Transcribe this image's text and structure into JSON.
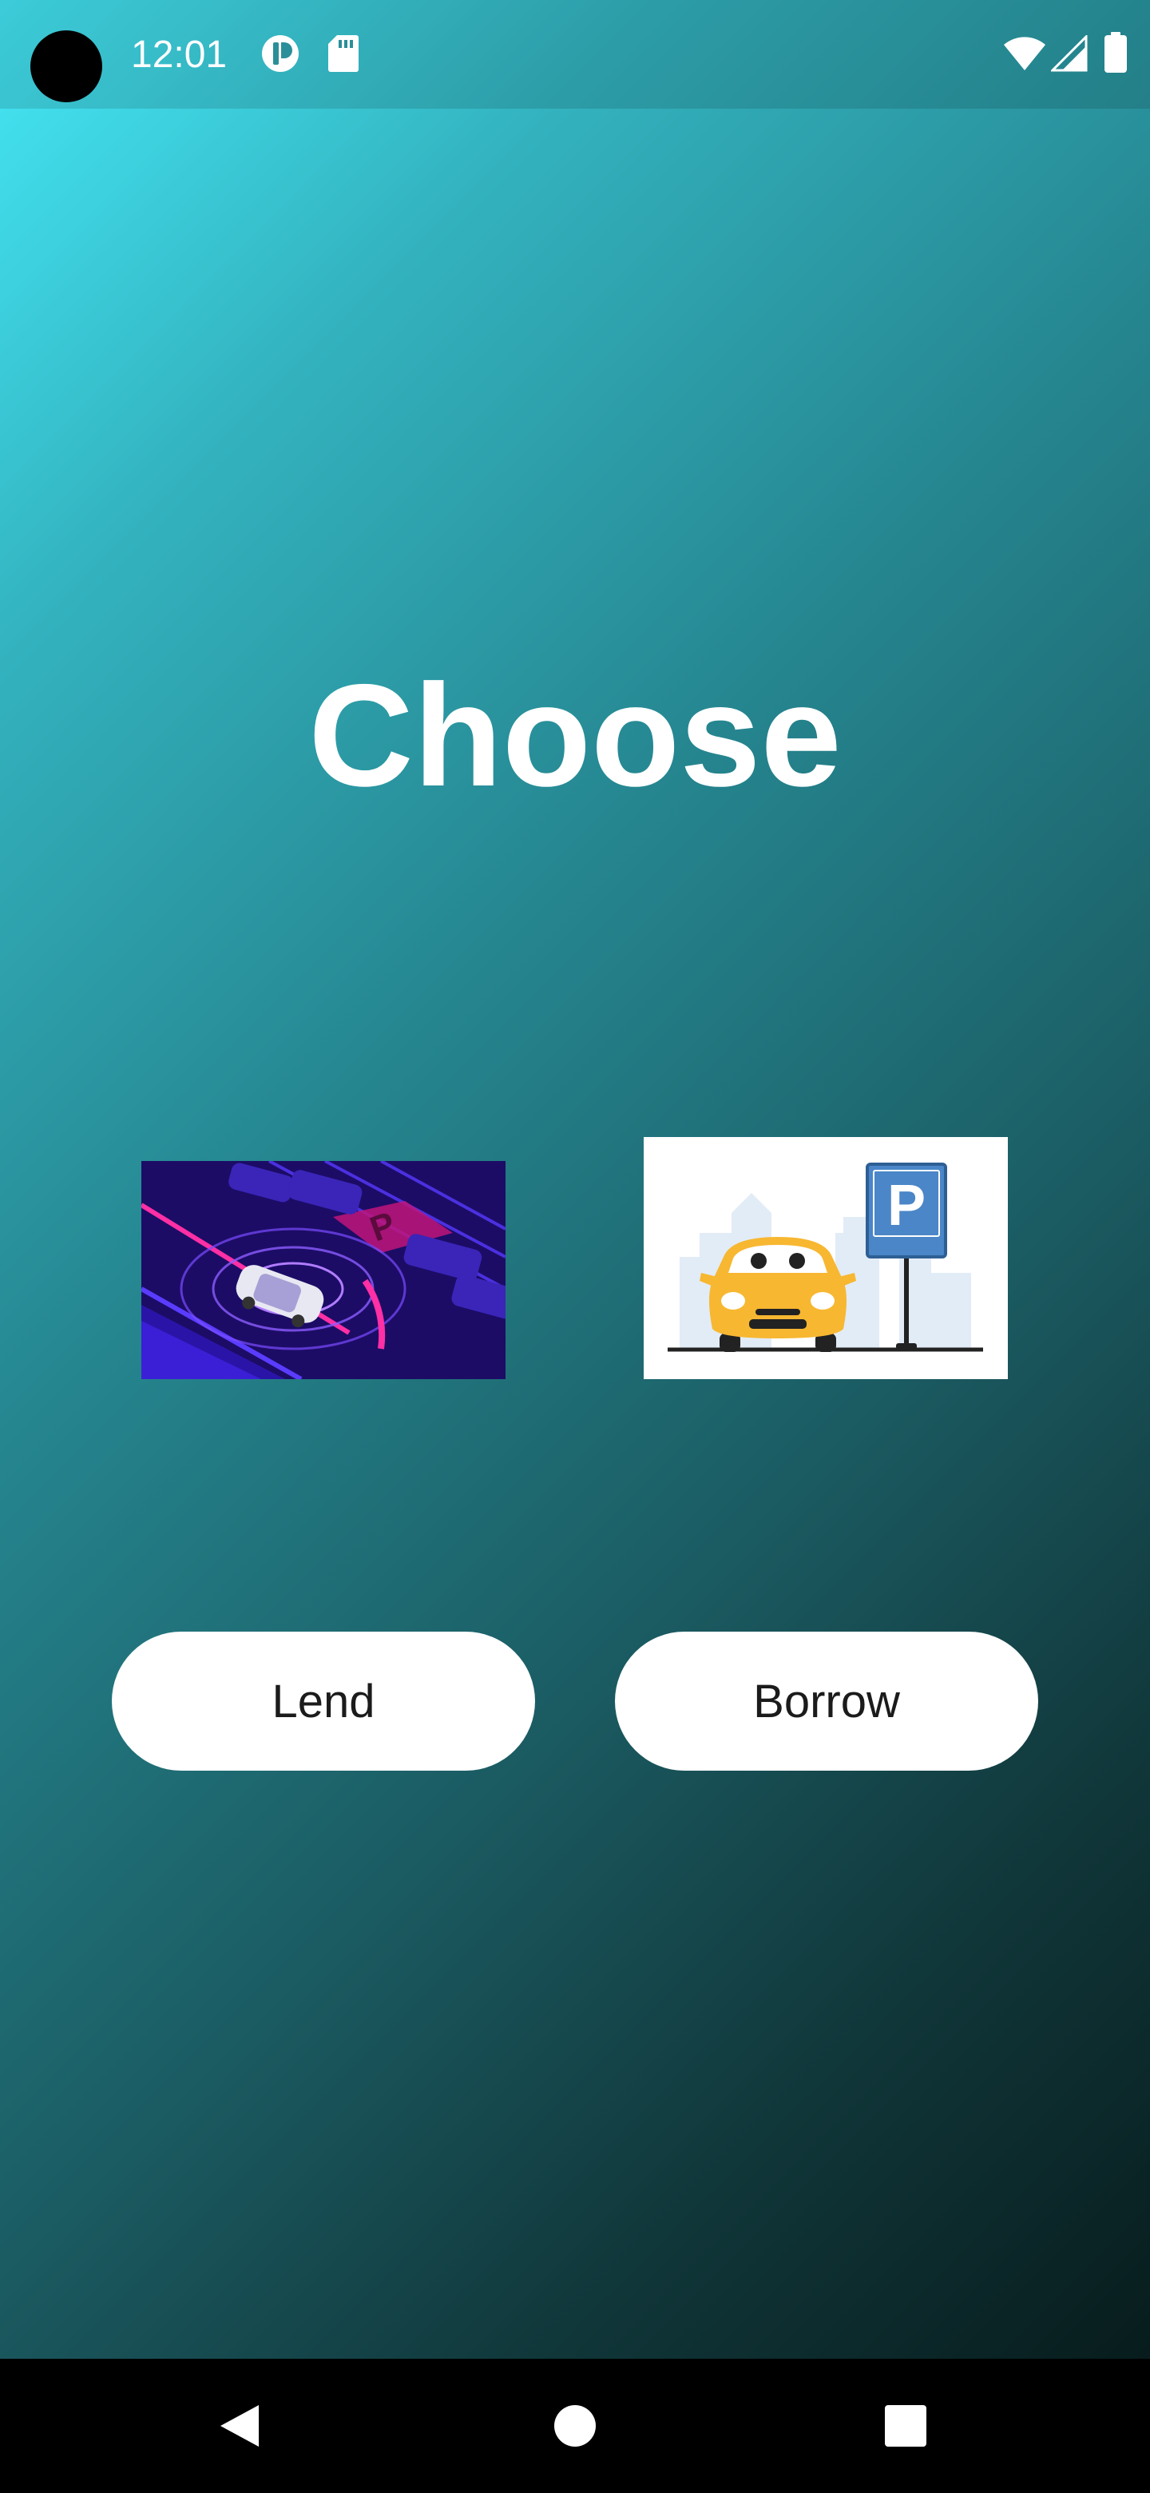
{
  "status_bar": {
    "time": "12:01",
    "icons": [
      "notification-app-icon",
      "sd-card-icon",
      "wifi-icon",
      "cellular-signal-icon",
      "battery-icon"
    ]
  },
  "main": {
    "title": "Choose",
    "options": [
      {
        "image_icon": "smart-parking-illustration",
        "button_label": "Lend"
      },
      {
        "image_icon": "car-parking-sign-illustration",
        "button_label": "Borrow"
      }
    ]
  },
  "nav_bar": {
    "icons": [
      "back-icon",
      "home-icon",
      "recents-icon"
    ]
  },
  "colors": {
    "gradient_top": "#45e8f7",
    "gradient_bottom": "#061616",
    "button_bg": "#ffffff",
    "button_text": "#1b1b1b",
    "parking_sign_blue": "#4a86c8",
    "car_yellow": "#f7b731"
  }
}
